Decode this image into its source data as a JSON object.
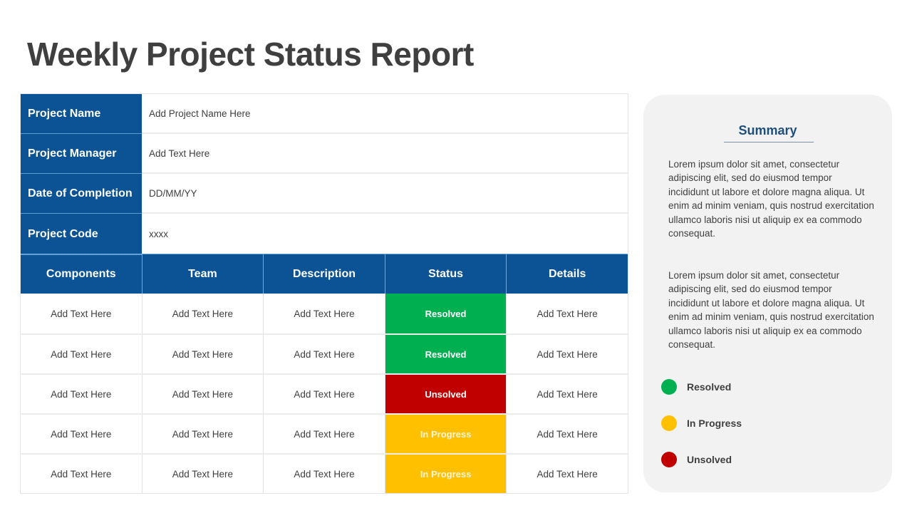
{
  "title": "Weekly Project Status Report",
  "project_info": [
    {
      "label": "Project Name",
      "value": "Add Project Name Here"
    },
    {
      "label": "Project Manager",
      "value": "Add Text Here"
    },
    {
      "label": "Date of Completion",
      "value": "DD/MM/YY"
    },
    {
      "label": "Project Code",
      "value": "xxxx"
    }
  ],
  "table": {
    "columns": [
      "Components",
      "Team",
      "Description",
      "Status",
      "Details"
    ],
    "rows": [
      {
        "components": "Add Text Here",
        "team": "Add Text Here",
        "description": "Add Text Here",
        "status": "Resolved",
        "details": "Add Text Here"
      },
      {
        "components": "Add Text Here",
        "team": "Add Text Here",
        "description": "Add Text Here",
        "status": "Resolved",
        "details": "Add Text Here"
      },
      {
        "components": "Add Text Here",
        "team": "Add Text Here",
        "description": "Add Text Here",
        "status": "Unsolved",
        "details": "Add Text Here"
      },
      {
        "components": "Add Text Here",
        "team": "Add Text Here",
        "description": "Add Text Here",
        "status": "In Progress",
        "details": "Add Text Here"
      },
      {
        "components": "Add Text Here",
        "team": "Add Text Here",
        "description": "Add Text Here",
        "status": "In Progress",
        "details": "Add Text Here"
      }
    ]
  },
  "summary": {
    "title": "Summary",
    "paragraphs": [
      "Lorem ipsum dolor sit amet, consectetur adipiscing elit, sed do eiusmod tempor incididunt ut labore et dolore magna aliqua. Ut enim ad minim veniam, quis nostrud exercitation ullamco laboris nisi ut aliquip ex ea commodo  consequat.",
      "Lorem ipsum dolor sit amet, consectetur adipiscing elit, sed do eiusmod tempor incididunt ut labore et dolore magna aliqua. Ut enim ad minim veniam, quis nostrud exercitation ullamco laboris nisi ut aliquip ex ea commodo  consequat."
    ]
  },
  "legend": [
    {
      "label": "Resolved",
      "color": "#00b050",
      "icon": "green-circle-icon"
    },
    {
      "label": "In Progress",
      "color": "#ffc000",
      "icon": "yellow-circle-icon"
    },
    {
      "label": "Unsolved",
      "color": "#c00000",
      "icon": "red-circle-icon"
    }
  ],
  "colors": {
    "header_blue": "#0b5394",
    "summary_title": "#1f4e79",
    "resolved": "#00b050",
    "in_progress": "#ffc000",
    "unsolved": "#c00000",
    "panel_bg": "#f2f2f2"
  }
}
